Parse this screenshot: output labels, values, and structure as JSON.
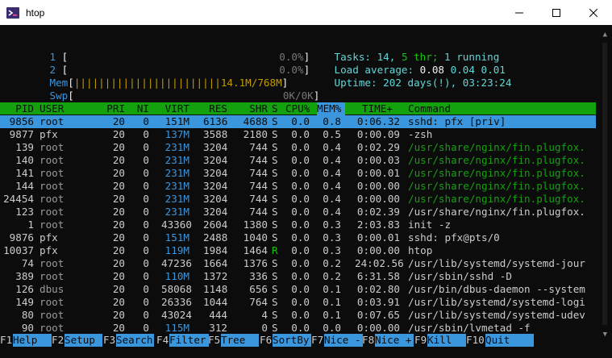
{
  "window": {
    "title": "htop"
  },
  "meters": {
    "cpu1": {
      "label": "1",
      "value": "0.0%"
    },
    "cpu2": {
      "label": "2",
      "value": "0.0%"
    },
    "mem": {
      "label": "Mem",
      "bars": "||||||||||||||||||||||||",
      "value": "14.1M/768M"
    },
    "swp": {
      "label": "Swp",
      "value": "0K/0K"
    }
  },
  "summary": {
    "tasks_label": "Tasks:",
    "tasks_count": "14,",
    "threads": "5 thr;",
    "running": "1 running",
    "load_label": "Load average:",
    "load1": "0.08",
    "load5": "0.04",
    "load15": "0.01",
    "uptime_label": "Uptime:",
    "uptime_value": "202 days(!), 03:23:24"
  },
  "columns": [
    "PID",
    "USER",
    "PRI",
    "NI",
    "VIRT",
    "RES",
    "SHR",
    "S",
    "CPU%",
    "MEM%",
    "TIME+",
    "Command"
  ],
  "processes": [
    {
      "pid": "9856",
      "user": "root",
      "pri": "20",
      "ni": "0",
      "virt": "151M",
      "res": "6136",
      "shr": "4688",
      "s": "S",
      "cpu": "0.0",
      "mem": "0.8",
      "time": "0:06.32",
      "cmd": "sshd: pfx [priv]"
    },
    {
      "pid": "9877",
      "user": "pfx",
      "pri": "20",
      "ni": "0",
      "virt": "137M",
      "res": "3588",
      "shr": "2180",
      "s": "S",
      "cpu": "0.0",
      "mem": "0.5",
      "time": "0:00.09",
      "cmd": "-zsh"
    },
    {
      "pid": "139",
      "user": "root",
      "pri": "20",
      "ni": "0",
      "virt": "231M",
      "res": "3204",
      "shr": "744",
      "s": "S",
      "cpu": "0.0",
      "mem": "0.4",
      "time": "0:02.29",
      "cmd": "/usr/share/nginx/fin.plugfox."
    },
    {
      "pid": "140",
      "user": "root",
      "pri": "20",
      "ni": "0",
      "virt": "231M",
      "res": "3204",
      "shr": "744",
      "s": "S",
      "cpu": "0.0",
      "mem": "0.4",
      "time": "0:00.03",
      "cmd": "/usr/share/nginx/fin.plugfox."
    },
    {
      "pid": "141",
      "user": "root",
      "pri": "20",
      "ni": "0",
      "virt": "231M",
      "res": "3204",
      "shr": "744",
      "s": "S",
      "cpu": "0.0",
      "mem": "0.4",
      "time": "0:00.01",
      "cmd": "/usr/share/nginx/fin.plugfox."
    },
    {
      "pid": "144",
      "user": "root",
      "pri": "20",
      "ni": "0",
      "virt": "231M",
      "res": "3204",
      "shr": "744",
      "s": "S",
      "cpu": "0.0",
      "mem": "0.4",
      "time": "0:00.00",
      "cmd": "/usr/share/nginx/fin.plugfox."
    },
    {
      "pid": "24454",
      "user": "root",
      "pri": "20",
      "ni": "0",
      "virt": "231M",
      "res": "3204",
      "shr": "744",
      "s": "S",
      "cpu": "0.0",
      "mem": "0.4",
      "time": "0:00.00",
      "cmd": "/usr/share/nginx/fin.plugfox."
    },
    {
      "pid": "123",
      "user": "root",
      "pri": "20",
      "ni": "0",
      "virt": "231M",
      "res": "3204",
      "shr": "744",
      "s": "S",
      "cpu": "0.0",
      "mem": "0.4",
      "time": "0:02.39",
      "cmd": "/usr/share/nginx/fin.plugfox."
    },
    {
      "pid": "1",
      "user": "root",
      "pri": "20",
      "ni": "0",
      "virt": "43360",
      "res": "2604",
      "shr": "1380",
      "s": "S",
      "cpu": "0.0",
      "mem": "0.3",
      "time": "2:03.83",
      "cmd": "init -z"
    },
    {
      "pid": "9876",
      "user": "pfx",
      "pri": "20",
      "ni": "0",
      "virt": "151M",
      "res": "2488",
      "shr": "1040",
      "s": "S",
      "cpu": "0.0",
      "mem": "0.3",
      "time": "0:00.01",
      "cmd": "sshd: pfx@pts/0"
    },
    {
      "pid": "10037",
      "user": "pfx",
      "pri": "20",
      "ni": "0",
      "virt": "119M",
      "res": "1984",
      "shr": "1464",
      "s": "R",
      "cpu": "0.0",
      "mem": "0.3",
      "time": "0:00.00",
      "cmd": "htop"
    },
    {
      "pid": "74",
      "user": "root",
      "pri": "20",
      "ni": "0",
      "virt": "47236",
      "res": "1664",
      "shr": "1376",
      "s": "S",
      "cpu": "0.0",
      "mem": "0.2",
      "time": "24:02.56",
      "cmd": "/usr/lib/systemd/systemd-jour"
    },
    {
      "pid": "389",
      "user": "root",
      "pri": "20",
      "ni": "0",
      "virt": "110M",
      "res": "1372",
      "shr": "336",
      "s": "S",
      "cpu": "0.0",
      "mem": "0.2",
      "time": "6:31.58",
      "cmd": "/usr/sbin/sshd -D"
    },
    {
      "pid": "126",
      "user": "dbus",
      "pri": "20",
      "ni": "0",
      "virt": "58068",
      "res": "1148",
      "shr": "656",
      "s": "S",
      "cpu": "0.0",
      "mem": "0.1",
      "time": "0:02.80",
      "cmd": "/usr/bin/dbus-daemon --system"
    },
    {
      "pid": "149",
      "user": "root",
      "pri": "20",
      "ni": "0",
      "virt": "26336",
      "res": "1044",
      "shr": "764",
      "s": "S",
      "cpu": "0.0",
      "mem": "0.1",
      "time": "0:03.91",
      "cmd": "/usr/lib/systemd/systemd-logi"
    },
    {
      "pid": "80",
      "user": "root",
      "pri": "20",
      "ni": "0",
      "virt": "43024",
      "res": "444",
      "shr": "4",
      "s": "S",
      "cpu": "0.0",
      "mem": "0.1",
      "time": "0:07.65",
      "cmd": "/usr/lib/systemd/systemd-udev"
    },
    {
      "pid": "90",
      "user": "root",
      "pri": "20",
      "ni": "0",
      "virt": "115M",
      "res": "312",
      "shr": "0",
      "s": "S",
      "cpu": "0.0",
      "mem": "0.0",
      "time": "0:00.00",
      "cmd": "/usr/sbin/lvmetad -f"
    }
  ],
  "footer": [
    {
      "key": "F1",
      "label": "Help"
    },
    {
      "key": "F2",
      "label": "Setup"
    },
    {
      "key": "F3",
      "label": "Search"
    },
    {
      "key": "F4",
      "label": "Filter"
    },
    {
      "key": "F5",
      "label": "Tree"
    },
    {
      "key": "F6",
      "label": "SortBy"
    },
    {
      "key": "F7",
      "label": "Nice -"
    },
    {
      "key": "F8",
      "label": "Nice +"
    },
    {
      "key": "F9",
      "label": "Kill"
    },
    {
      "key": "F10",
      "label": "Quit"
    }
  ],
  "colors": {
    "header_bg": "#13a10e",
    "selection_bg": "#3a96dd",
    "label": "#3a96dd"
  }
}
